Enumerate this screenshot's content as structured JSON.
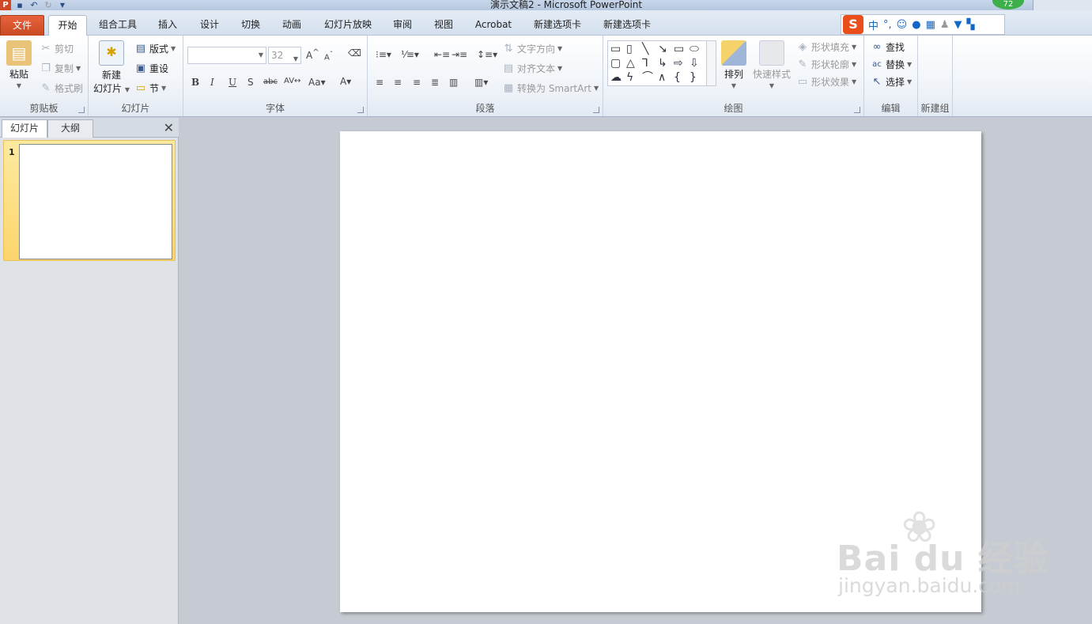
{
  "titlebar": {
    "title": "演示文稿2 - Microsoft PowerPoint",
    "badge": "72"
  },
  "tabs": [
    "文件",
    "开始",
    "组合工具",
    "插入",
    "设计",
    "切换",
    "动画",
    "幻灯片放映",
    "审阅",
    "视图",
    "Acrobat",
    "新建选项卡",
    "新建选项卡"
  ],
  "ime": {
    "logo": "S",
    "mode": "中"
  },
  "ribbon": {
    "clipboard": {
      "label": "剪贴板",
      "paste": "粘贴",
      "cut": "剪切",
      "copy": "复制",
      "format_painter": "格式刷"
    },
    "slides": {
      "label": "幻灯片",
      "new_slide_line1": "新建",
      "new_slide_line2": "幻灯片",
      "layout": "版式",
      "reset": "重设",
      "section": "节"
    },
    "font": {
      "label": "字体",
      "font_name": "",
      "font_size": "32"
    },
    "paragraph": {
      "label": "段落",
      "text_direction": "文字方向",
      "align_text": "对齐文本",
      "convert_smartart": "转换为 SmartArt"
    },
    "drawing": {
      "label": "绘图",
      "arrange": "排列",
      "quick_styles": "快速样式",
      "shape_fill": "形状填充",
      "shape_outline": "形状轮廓",
      "shape_effects": "形状效果"
    },
    "editing": {
      "label": "编辑",
      "find": "查找",
      "replace": "替换",
      "select": "选择"
    },
    "new_group": {
      "label": "新建组"
    }
  },
  "left_pane": {
    "tab_slides": "幻灯片",
    "tab_outline": "大纲",
    "slide_number": "1"
  },
  "watermark": {
    "brand": "Bai du 经验",
    "url": "jingyan.baidu.com"
  }
}
